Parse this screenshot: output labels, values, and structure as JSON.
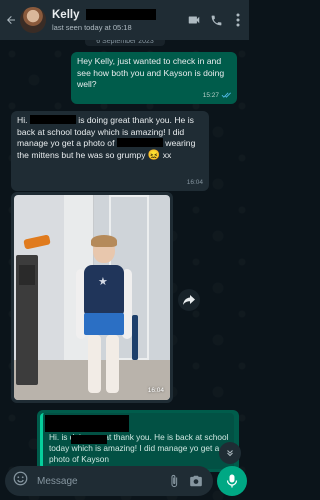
{
  "header": {
    "contact_name": "Kelly",
    "last_seen": "last seen today at 05:18"
  },
  "date_chip": "6 September 2023",
  "messages": [
    {
      "direction": "out",
      "text": "Hey Kelly, just wanted to check in and see how both you and Kayson is doing well?",
      "time": "15:27"
    },
    {
      "direction": "in",
      "text_parts": [
        "Hi.",
        "He is back at school today which is amazing! I did manage yo get a photo of",
        "wearing the mittens but he was so grumpy",
        "xx"
      ],
      "time": "16:04"
    },
    {
      "direction": "in",
      "type": "photo",
      "time": "16:04"
    },
    {
      "direction": "out",
      "quoted_text": "Hi.        is doing great thank you. He is back at school today which is amazing! I did manage yo get a photo of Kayson"
    }
  ],
  "input": {
    "placeholder": "Message"
  },
  "colors": {
    "header_bg": "#1f2c34",
    "outgoing_bubble": "#005c4b",
    "incoming_bubble": "#1f2c34",
    "accent": "#00a884"
  }
}
